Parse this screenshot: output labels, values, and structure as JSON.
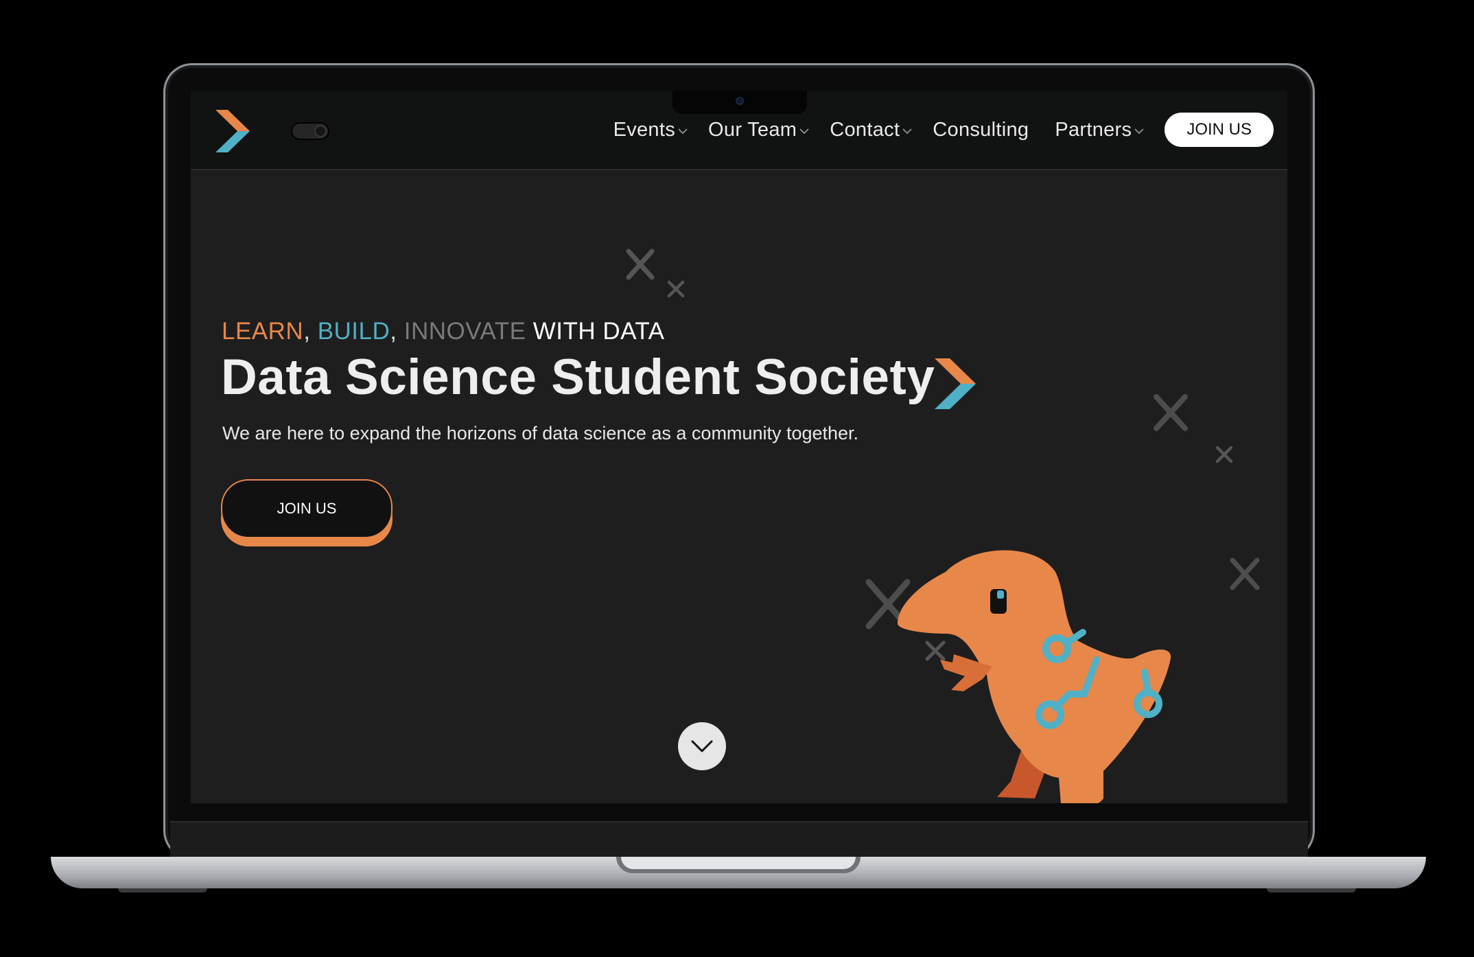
{
  "nav": {
    "items": [
      {
        "label": "Events",
        "has_dropdown": true
      },
      {
        "label": "Our Team",
        "has_dropdown": true
      },
      {
        "label": "Contact",
        "has_dropdown": true
      },
      {
        "label": "Consulting",
        "has_dropdown": false
      },
      {
        "label": "Partners",
        "has_dropdown": true
      }
    ],
    "join_label": "JOIN US"
  },
  "hero": {
    "tagline": {
      "learn": "LEARN",
      "comma1": ",",
      "build": "BUILD",
      "comma2": ",",
      "innovate": "INNOVATE",
      "rest": "WITH DATA"
    },
    "title": "Data Science Student Society",
    "subtitle": "We are here to expand the horizons of data science as a community together.",
    "join_label": "JOIN US"
  },
  "colors": {
    "accent_orange": "#e8874a",
    "accent_blue": "#4fb0c6",
    "background": "#1e1e1e",
    "navbar": "#111212"
  },
  "icons": {
    "logo": "chevron-logo-icon",
    "toggle": "theme-toggle-icon",
    "scroll": "chevron-down-icon",
    "mascot": "dinosaur-mascot-icon"
  }
}
